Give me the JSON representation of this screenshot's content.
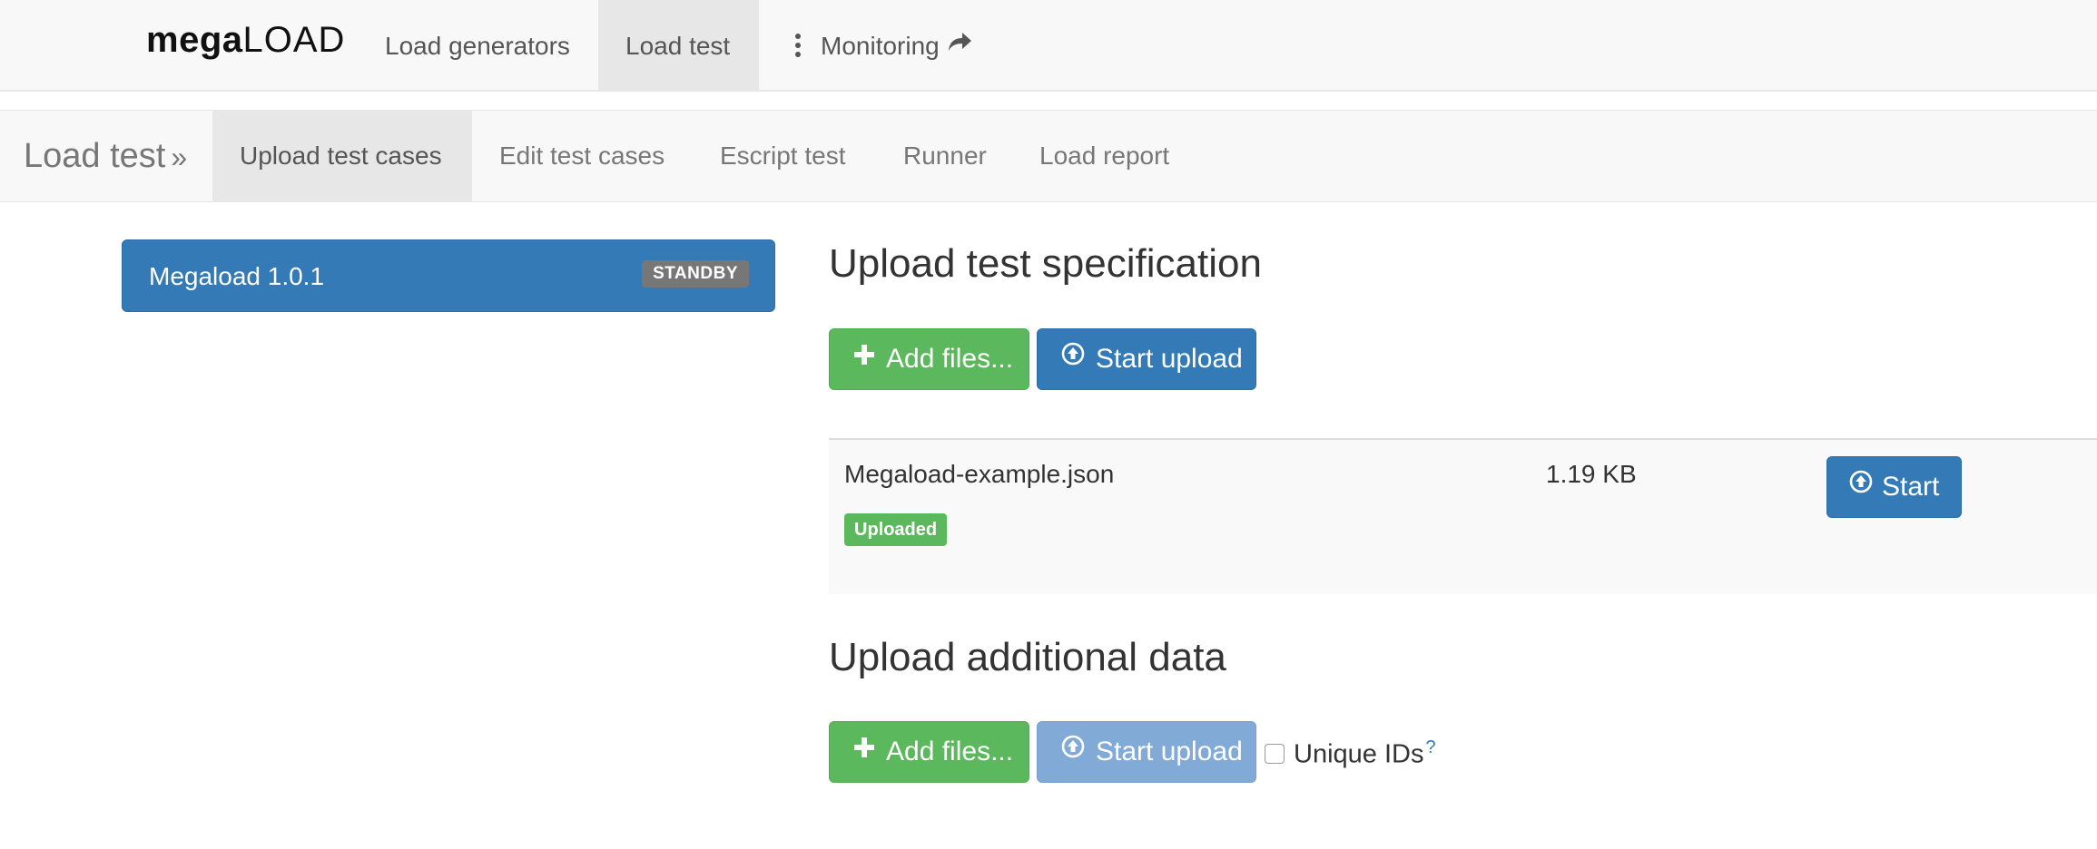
{
  "brand": {
    "part1": "mega",
    "part2": "LOAD"
  },
  "topnav": {
    "items": [
      {
        "label": "Load generators"
      },
      {
        "label": "Load test"
      },
      {
        "label": "Monitoring"
      }
    ]
  },
  "subnav": {
    "brand": "Load test",
    "brand_suffix": "»",
    "items": [
      {
        "label": "Upload test cases"
      },
      {
        "label": "Edit test cases"
      },
      {
        "label": "Escript test"
      },
      {
        "label": "Runner"
      },
      {
        "label": "Load report"
      }
    ]
  },
  "version_panel": {
    "title": "Megaload 1.0.1",
    "status": "STANDBY"
  },
  "spec_section": {
    "title": "Upload test specification",
    "add_files_label": "Add files...",
    "start_upload_label": "Start upload"
  },
  "file": {
    "name": "Megaload-example.json",
    "size": "1.19 KB",
    "status": "Uploaded",
    "start_label": "Start"
  },
  "additional_section": {
    "title": "Upload additional data",
    "add_files_label": "Add files...",
    "start_upload_label": "Start upload",
    "unique_ids_label": "Unique IDs",
    "help_mark": "?",
    "unique_ids_checked": false
  },
  "colors": {
    "primary": "#337ab7",
    "success": "#5cb85c",
    "primary_disabled": "#82aad6",
    "badge_gray": "#777777",
    "navbar_bg": "#f8f8f8",
    "active_nav_bg": "#e7e7e7"
  },
  "icons": {
    "plus": "plus-icon",
    "upload": "circle-arrow-up-icon",
    "kebab": "vertical-dots-icon",
    "share": "share-arrow-icon"
  }
}
